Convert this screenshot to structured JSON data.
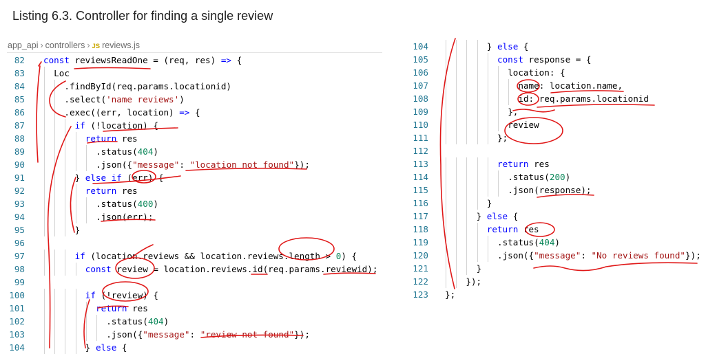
{
  "heading": "Listing 6.3. Controller for finding a single review",
  "breadcrumb": {
    "folder1": "app_api",
    "folder2": "controllers",
    "file_badge": "JS",
    "file": "reviews.js"
  },
  "colors": {
    "keyword": "#0000ff",
    "string": "#a31515",
    "number": "#098658",
    "line_number": "#237893",
    "annotation": "#e01818"
  },
  "left_code": [
    {
      "n": "82",
      "indent": 0,
      "tokens": [
        [
          "kw",
          "const"
        ],
        [
          "t",
          " reviewsReadOne = (req, res) "
        ],
        [
          "kw",
          "=>"
        ],
        [
          "t",
          " {"
        ]
      ]
    },
    {
      "n": "83",
      "indent": 1,
      "tokens": [
        [
          "t",
          "Loc"
        ]
      ]
    },
    {
      "n": "84",
      "indent": 2,
      "tokens": [
        [
          "t",
          ".findById(req.params.locationid)"
        ]
      ]
    },
    {
      "n": "85",
      "indent": 2,
      "tokens": [
        [
          "t",
          ".select("
        ],
        [
          "str",
          "'name reviews'"
        ],
        [
          "t",
          ")"
        ]
      ]
    },
    {
      "n": "86",
      "indent": 2,
      "tokens": [
        [
          "t",
          ".exec((err, location) "
        ],
        [
          "kw",
          "=>"
        ],
        [
          "t",
          " {"
        ]
      ]
    },
    {
      "n": "87",
      "indent": 3,
      "tokens": [
        [
          "kw",
          "if"
        ],
        [
          "t",
          " (!location) {"
        ]
      ]
    },
    {
      "n": "88",
      "indent": 4,
      "tokens": [
        [
          "kw",
          "return"
        ],
        [
          "t",
          " res"
        ]
      ]
    },
    {
      "n": "89",
      "indent": 5,
      "tokens": [
        [
          "t",
          ".status("
        ],
        [
          "num",
          "404"
        ],
        [
          "t",
          ")"
        ]
      ]
    },
    {
      "n": "90",
      "indent": 5,
      "tokens": [
        [
          "t",
          ".json({"
        ],
        [
          "str",
          "\"message\""
        ],
        [
          "t",
          ": "
        ],
        [
          "str",
          "\"location not found\""
        ],
        [
          "t",
          "});"
        ]
      ]
    },
    {
      "n": "91",
      "indent": 3,
      "tokens": [
        [
          "t",
          "} "
        ],
        [
          "kw",
          "else if"
        ],
        [
          "t",
          " (err) {"
        ]
      ]
    },
    {
      "n": "92",
      "indent": 4,
      "tokens": [
        [
          "kw",
          "return"
        ],
        [
          "t",
          " res"
        ]
      ]
    },
    {
      "n": "93",
      "indent": 5,
      "tokens": [
        [
          "t",
          ".status("
        ],
        [
          "num",
          "400"
        ],
        [
          "t",
          ")"
        ]
      ]
    },
    {
      "n": "94",
      "indent": 5,
      "tokens": [
        [
          "t",
          ".json(err);"
        ]
      ]
    },
    {
      "n": "95",
      "indent": 3,
      "tokens": [
        [
          "t",
          "}"
        ]
      ]
    },
    {
      "n": "96",
      "indent": 0,
      "tokens": []
    },
    {
      "n": "97",
      "indent": 3,
      "tokens": [
        [
          "kw",
          "if"
        ],
        [
          "t",
          " (location.reviews && location.reviews.length > "
        ],
        [
          "num",
          "0"
        ],
        [
          "t",
          ") {"
        ]
      ]
    },
    {
      "n": "98",
      "indent": 4,
      "tokens": [
        [
          "kw",
          "const"
        ],
        [
          "t",
          " review = location.reviews.id(req.params.reviewid);"
        ]
      ]
    },
    {
      "n": "99",
      "indent": 0,
      "tokens": []
    },
    {
      "n": "100",
      "indent": 4,
      "tokens": [
        [
          "kw",
          "if"
        ],
        [
          "t",
          " (!review) {"
        ]
      ]
    },
    {
      "n": "101",
      "indent": 5,
      "tokens": [
        [
          "kw",
          "return"
        ],
        [
          "t",
          " res"
        ]
      ]
    },
    {
      "n": "102",
      "indent": 6,
      "tokens": [
        [
          "t",
          ".status("
        ],
        [
          "num",
          "404"
        ],
        [
          "t",
          ")"
        ]
      ]
    },
    {
      "n": "103",
      "indent": 6,
      "tokens": [
        [
          "t",
          ".json({"
        ],
        [
          "str",
          "\"message\""
        ],
        [
          "t",
          ": "
        ],
        [
          "str",
          "\"review not found\""
        ],
        [
          "t",
          "});"
        ]
      ]
    },
    {
      "n": "104",
      "indent": 4,
      "tokens": [
        [
          "t",
          "} "
        ],
        [
          "kw",
          "else"
        ],
        [
          "t",
          " {"
        ]
      ]
    }
  ],
  "right_code": [
    {
      "n": "104",
      "indent": 4,
      "tokens": [
        [
          "t",
          "} "
        ],
        [
          "kw",
          "else"
        ],
        [
          "t",
          " {"
        ]
      ]
    },
    {
      "n": "105",
      "indent": 5,
      "tokens": [
        [
          "kw",
          "const"
        ],
        [
          "t",
          " response = {"
        ]
      ]
    },
    {
      "n": "106",
      "indent": 6,
      "tokens": [
        [
          "t",
          "location: {"
        ]
      ]
    },
    {
      "n": "107",
      "indent": 7,
      "tokens": [
        [
          "t",
          "name: location.name,"
        ]
      ]
    },
    {
      "n": "108",
      "indent": 7,
      "tokens": [
        [
          "t",
          "id: req.params.locationid"
        ]
      ]
    },
    {
      "n": "109",
      "indent": 6,
      "tokens": [
        [
          "t",
          "},"
        ]
      ]
    },
    {
      "n": "110",
      "indent": 6,
      "tokens": [
        [
          "t",
          "review"
        ]
      ]
    },
    {
      "n": "111",
      "indent": 5,
      "tokens": [
        [
          "t",
          "};"
        ]
      ]
    },
    {
      "n": "112",
      "indent": 0,
      "tokens": []
    },
    {
      "n": "113",
      "indent": 5,
      "tokens": [
        [
          "kw",
          "return"
        ],
        [
          "t",
          " res"
        ]
      ]
    },
    {
      "n": "114",
      "indent": 6,
      "tokens": [
        [
          "t",
          ".status("
        ],
        [
          "num",
          "200"
        ],
        [
          "t",
          ")"
        ]
      ]
    },
    {
      "n": "115",
      "indent": 6,
      "tokens": [
        [
          "t",
          ".json(response);"
        ]
      ]
    },
    {
      "n": "116",
      "indent": 4,
      "tokens": [
        [
          "t",
          "}"
        ]
      ]
    },
    {
      "n": "117",
      "indent": 3,
      "tokens": [
        [
          "t",
          "} "
        ],
        [
          "kw",
          "else"
        ],
        [
          "t",
          " {"
        ]
      ]
    },
    {
      "n": "118",
      "indent": 4,
      "tokens": [
        [
          "kw",
          "return"
        ],
        [
          "t",
          " res"
        ]
      ]
    },
    {
      "n": "119",
      "indent": 5,
      "tokens": [
        [
          "t",
          ".status("
        ],
        [
          "num",
          "404"
        ],
        [
          "t",
          ")"
        ]
      ]
    },
    {
      "n": "120",
      "indent": 5,
      "tokens": [
        [
          "t",
          ".json({"
        ],
        [
          "str",
          "\"message\""
        ],
        [
          "t",
          ": "
        ],
        [
          "str",
          "\"No reviews found\""
        ],
        [
          "t",
          "});"
        ]
      ]
    },
    {
      "n": "121",
      "indent": 3,
      "tokens": [
        [
          "t",
          "}"
        ]
      ]
    },
    {
      "n": "122",
      "indent": 2,
      "tokens": [
        [
          "t",
          "});"
        ]
      ]
    },
    {
      "n": "123",
      "indent": 0,
      "tokens": [
        [
          "t",
          "};"
        ]
      ]
    }
  ]
}
